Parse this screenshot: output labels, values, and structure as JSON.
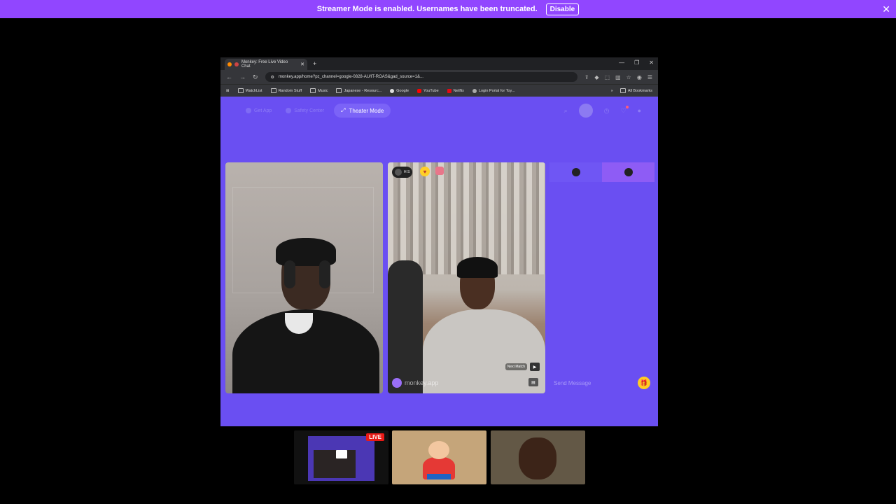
{
  "banner": {
    "message": "Streamer Mode is enabled. Usernames have been truncated.",
    "disable_label": "Disable",
    "close_glyph": "✕"
  },
  "browser": {
    "tab_title": "Monkey: Free Live Video Chat",
    "new_tab_glyph": "+",
    "url": "monkey.app/home?pz_channel=google-0828-AU/IT-ROAS&gad_source=1&...",
    "bookmarks": [
      {
        "label": "WatchList"
      },
      {
        "label": "Random Stuff"
      },
      {
        "label": "Music"
      },
      {
        "label": "Japanese - Resourc..."
      },
      {
        "label": "Google"
      },
      {
        "label": "YouTube"
      },
      {
        "label": "Netflix"
      },
      {
        "label": "Login Portal for Toy..."
      }
    ],
    "all_bookmarks": "All Bookmarks",
    "more_glyph": "»"
  },
  "page": {
    "nav": {
      "get_app": "Get App",
      "safety_center": "Safety Center",
      "theater_mode": "Theater Mode"
    },
    "videos": {
      "user_chip": "H S",
      "logo_text": "monkey.app",
      "next_match": "Next Match"
    },
    "chat": {
      "placeholder": "Send Message"
    }
  },
  "stream": {
    "live_badge": "LIVE"
  },
  "colors": {
    "banner": "#9146ff",
    "page_bg": "#6a4ff2",
    "live": "#e91916"
  }
}
